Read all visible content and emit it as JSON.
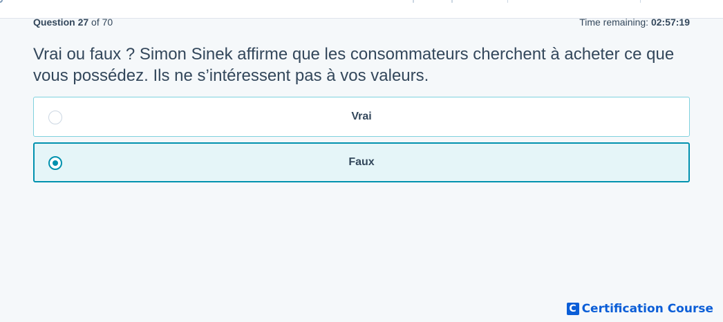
{
  "header": {
    "question_label": "Question",
    "question_number": "27",
    "question_of": "of 70",
    "timer_label": "Time remaining:",
    "timer_value": "02:57:19"
  },
  "question": {
    "text": "Vrai ou faux ? Simon Sinek affirme que les consommateurs cherchent à acheter ce que vous possédez. Ils ne s’intéressent pas à vos valeurs."
  },
  "options": [
    {
      "label": "Vrai",
      "selected": false
    },
    {
      "label": "Faux",
      "selected": true
    }
  ],
  "brand": {
    "logo_letter": "C",
    "text": "Certification Course",
    "color": "#0b5ed7"
  },
  "colors": {
    "accent": "#0091ae",
    "selected_bg": "#e5f5f8",
    "text": "#33475b"
  }
}
